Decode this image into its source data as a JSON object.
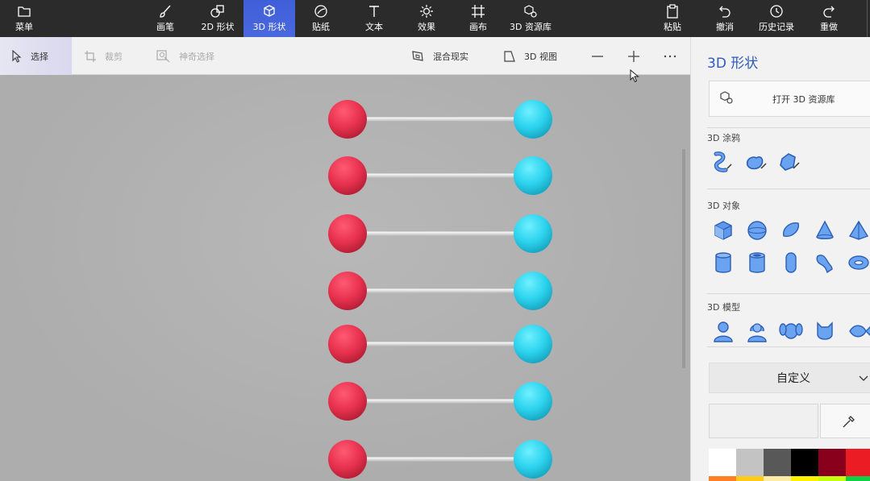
{
  "topbar": {
    "menu": "菜单",
    "brush": "画笔",
    "shapes2d": "2D 形状",
    "shapes3d": "3D 形状",
    "stickers": "贴纸",
    "text": "文本",
    "effects": "效果",
    "canvas": "画布",
    "library3d": "3D 资源库",
    "paste": "粘贴",
    "undo": "撤消",
    "history": "历史记录",
    "redo": "重做"
  },
  "subbar": {
    "select": "选择",
    "crop": "裁剪",
    "magic_select": "神奇选择",
    "mixed_reality": "混合现实",
    "view3d": "3D 视图"
  },
  "canvas": {
    "rows": 7,
    "left_color": "#e8324f",
    "right_color": "#2cd3ee",
    "rod_color": "#d9d9d9"
  },
  "panel": {
    "title": "3D 形状",
    "open_library": "打开 3D 资源库",
    "doodle_title": "3D 涂鸦",
    "objects_title": "3D 对象",
    "models_title": "3D 模型",
    "custom": "自定义",
    "palette": [
      "#ffffff",
      "#c3c3c3",
      "#585858",
      "#000000",
      "#88001b",
      "#ec1c24"
    ],
    "palette_row2": [
      "#ff7f27",
      "#ffca18",
      "#fdeca6",
      "#fff200",
      "#c4ff0e",
      "#0ed145"
    ]
  },
  "accent": "#3f5fd9"
}
